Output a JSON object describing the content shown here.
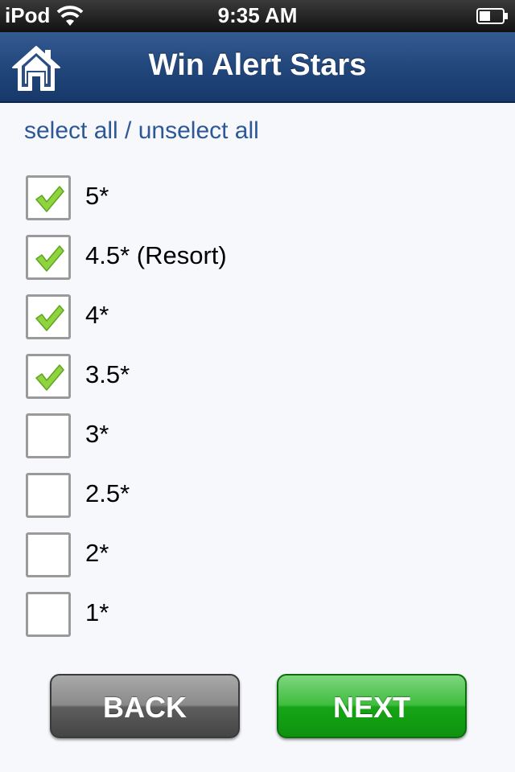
{
  "status_bar": {
    "carrier": "iPod",
    "time": "9:35 AM",
    "wifi_icon": "wifi-icon",
    "battery_icon": "battery-icon"
  },
  "nav": {
    "title": "Win Alert Stars",
    "home_icon": "home-icon",
    "bar_color": "#22477c"
  },
  "select_all": {
    "label": "select all / unselect all",
    "color": "#2d5897"
  },
  "options": [
    {
      "label": "5*",
      "checked": true
    },
    {
      "label": "4.5* (Resort)",
      "checked": true
    },
    {
      "label": "4*",
      "checked": true
    },
    {
      "label": "3.5*",
      "checked": true
    },
    {
      "label": "3*",
      "checked": false
    },
    {
      "label": "2.5*",
      "checked": false
    },
    {
      "label": "2*",
      "checked": false
    },
    {
      "label": "1*",
      "checked": false
    }
  ],
  "buttons": {
    "back_label": "BACK",
    "next_label": "NEXT",
    "back_color": "#5e5e5e",
    "next_color": "#16a516"
  }
}
